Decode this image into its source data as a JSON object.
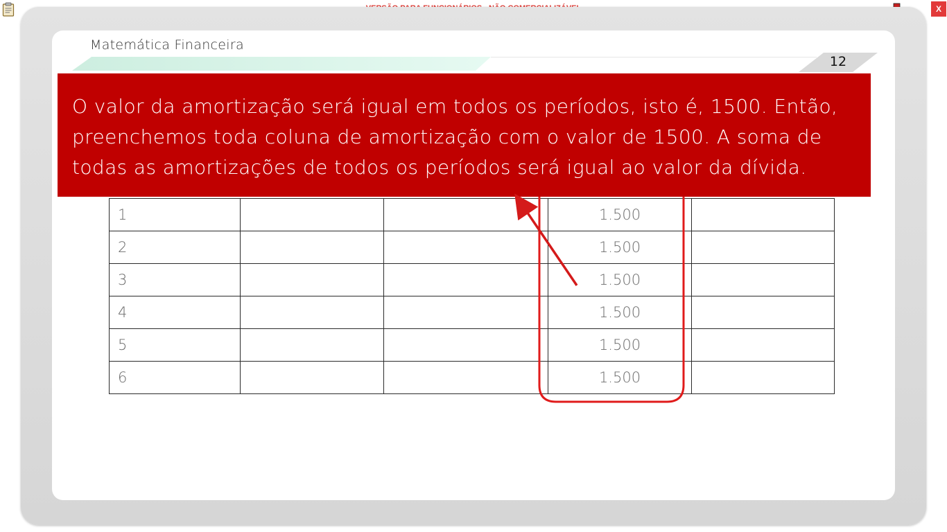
{
  "top_bar": {
    "watermark": "VERSÃO PARA FUNCIONÁRIOS - NÃO COMERCIALIZÁVEL",
    "close_label": "X",
    "icons": [
      "clipboard-icon",
      "network-icon"
    ]
  },
  "slide": {
    "course_title": "Matemática Financeira",
    "page_number": "12",
    "banner_text": "O valor da amortização será igual em todos os períodos, isto é, 1500. Então, preenchemos toda coluna de amortização com o valor de 1500. A soma de todas as amortizações de todos os períodos será igual ao valor da dívida.",
    "table": {
      "rows": [
        {
          "period": "1",
          "amortization": "1.500"
        },
        {
          "period": "2",
          "amortization": "1.500"
        },
        {
          "period": "3",
          "amortization": "1.500"
        },
        {
          "period": "4",
          "amortization": "1.500"
        },
        {
          "period": "5",
          "amortization": "1.500"
        },
        {
          "period": "6",
          "amortization": "1.500"
        }
      ]
    }
  },
  "colors": {
    "banner": "#c00000",
    "highlight": "#e01b1b",
    "watermark": "#e0443e",
    "frame": "#dcdcdc"
  }
}
